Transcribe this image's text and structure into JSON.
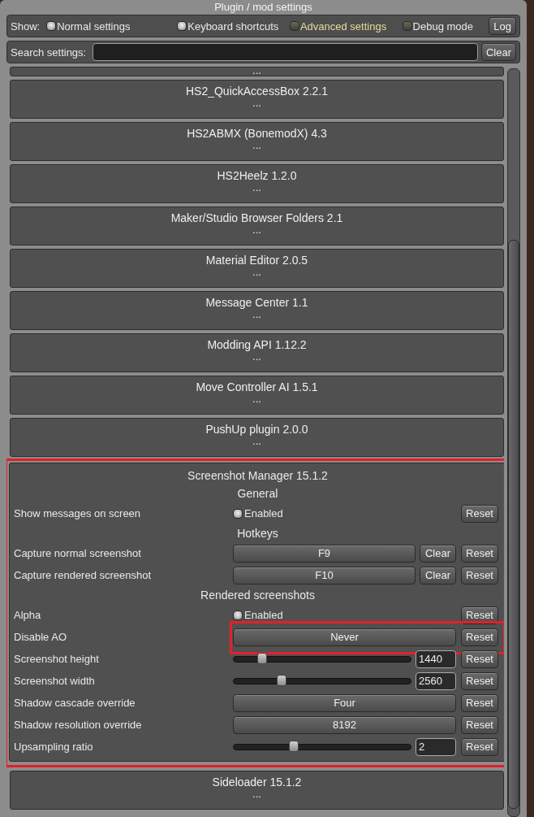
{
  "window": {
    "title": "Plugin / mod settings"
  },
  "filter_bar": {
    "label": "Show:",
    "toggles": [
      {
        "label": "Normal settings",
        "checked": true,
        "highlighted": false
      },
      {
        "label": "Keyboard shortcuts",
        "checked": true,
        "highlighted": false
      },
      {
        "label": "Advanced settings",
        "checked": false,
        "highlighted": true
      },
      {
        "label": "Debug mode",
        "checked": false,
        "highlighted": false
      }
    ],
    "log_button": "Log"
  },
  "search": {
    "label": "Search settings:",
    "clear_button": "Clear"
  },
  "plugins_above": [
    {
      "more": "..."
    },
    {
      "name": "HS2_QuickAccessBox 2.2.1",
      "more": "..."
    },
    {
      "name": "HS2ABMX (BonemodX) 4.3",
      "more": "..."
    },
    {
      "name": "HS2Heelz 1.2.0",
      "more": "..."
    },
    {
      "name": "Maker/Studio Browser Folders 2.1",
      "more": "..."
    },
    {
      "name": "Material Editor 2.0.5",
      "more": "..."
    },
    {
      "name": "Message Center 1.1",
      "more": "..."
    },
    {
      "name": "Modding API 1.12.2",
      "more": "..."
    },
    {
      "name": "Move Controller AI 1.5.1",
      "more": "..."
    },
    {
      "name": "PushUp plugin 2.0.0",
      "more": "..."
    }
  ],
  "expanded_plugin": {
    "name": "Screenshot Manager 15.1.2",
    "annotated": true,
    "sections": [
      {
        "heading": "General",
        "settings": [
          {
            "label": "Show messages on screen",
            "kind": "checkbox",
            "text": "Enabled",
            "checked": true,
            "reset": "Reset",
            "annotated": false
          }
        ]
      },
      {
        "heading": "Hotkeys",
        "settings": [
          {
            "label": "Capture normal screenshot",
            "kind": "hotkey",
            "value": "F9",
            "clear": "Clear",
            "reset": "Reset",
            "annotated": false
          },
          {
            "label": "Capture rendered screenshot",
            "kind": "hotkey",
            "value": "F10",
            "clear": "Clear",
            "reset": "Reset",
            "annotated": false
          }
        ]
      },
      {
        "heading": "Rendered screenshots",
        "settings": [
          {
            "label": "Alpha",
            "kind": "checkbox",
            "text": "Enabled",
            "checked": true,
            "reset": "Reset",
            "annotated": false
          },
          {
            "label": "Disable AO",
            "kind": "choice",
            "value": "Never",
            "reset": "Reset",
            "annotated": true
          },
          {
            "label": "Screenshot height",
            "kind": "slider",
            "level": 0.16,
            "value": "1440",
            "reset": "Reset",
            "annotated": false
          },
          {
            "label": "Screenshot width",
            "kind": "slider",
            "level": 0.27,
            "value": "2560",
            "reset": "Reset",
            "annotated": false
          },
          {
            "label": "Shadow cascade override",
            "kind": "choice",
            "value": "Four",
            "reset": "Reset",
            "annotated": false
          },
          {
            "label": "Shadow resolution override",
            "kind": "choice",
            "value": "8192",
            "reset": "Reset",
            "annotated": false
          },
          {
            "label": "Upsampling ratio",
            "kind": "slider",
            "level": 0.34,
            "value": "2",
            "reset": "Reset",
            "annotated": false
          }
        ]
      }
    ]
  },
  "plugins_below": [
    {
      "name": "Sideloader 15.1.2",
      "more": "..."
    }
  ]
}
